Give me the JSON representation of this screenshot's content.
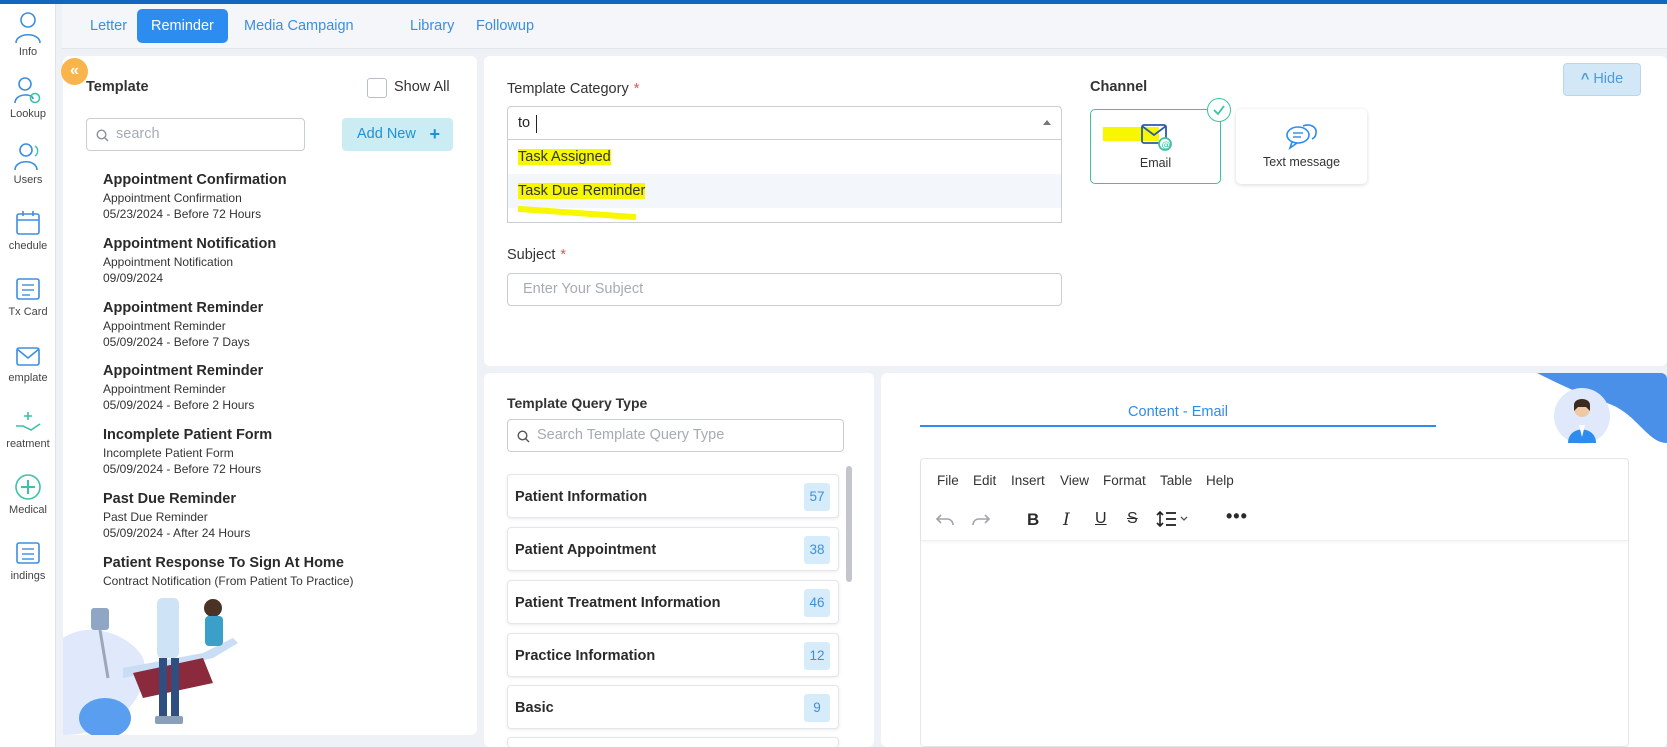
{
  "rail": {
    "items": [
      {
        "label": "Info",
        "icon": "person-icon"
      },
      {
        "label": "Lookup",
        "icon": "person-search-icon"
      },
      {
        "label": "Users",
        "icon": "users-icon"
      },
      {
        "label": "chedule",
        "icon": "calendar-icon"
      },
      {
        "label": "Tx Card",
        "icon": "card-icon"
      },
      {
        "label": "emplate",
        "icon": "mail-template-icon"
      },
      {
        "label": "reatment",
        "icon": "hand-treatment-icon"
      },
      {
        "label": "Medical",
        "icon": "medical-cross-icon"
      },
      {
        "label": "indings",
        "icon": "findings-icon"
      }
    ]
  },
  "tabs": [
    {
      "label": "Letter",
      "active": false
    },
    {
      "label": "Reminder",
      "active": true
    },
    {
      "label": "Media Campaign",
      "active": false
    },
    {
      "label": "Library",
      "active": false
    },
    {
      "label": "Followup",
      "active": false
    }
  ],
  "template_panel": {
    "title": "Template",
    "show_all_label": "Show All",
    "search_placeholder": "search",
    "add_new_label": "Add New",
    "items": [
      {
        "title": "Appointment Confirmation",
        "subtitle": "Appointment Confirmation",
        "meta": "05/23/2024 - Before 72 Hours"
      },
      {
        "title": "Appointment Notification",
        "subtitle": "Appointment Notification",
        "meta": "09/09/2024"
      },
      {
        "title": "Appointment Reminder",
        "subtitle": "Appointment Reminder",
        "meta": "05/09/2024 - Before 7 Days"
      },
      {
        "title": "Appointment Reminder",
        "subtitle": "Appointment Reminder",
        "meta": "05/09/2024 - Before 2 Hours"
      },
      {
        "title": "Incomplete Patient Form",
        "subtitle": "Incomplete Patient Form",
        "meta": "05/09/2024 - Before 72 Hours"
      },
      {
        "title": "Past Due Reminder",
        "subtitle": "Past Due Reminder",
        "meta": "05/09/2024 - After 24 Hours"
      },
      {
        "title": "Patient Response To Sign At Home",
        "subtitle": "Contract Notification (From Patient To Practice)",
        "meta": ""
      }
    ]
  },
  "form": {
    "category_label": "Template Category",
    "required_mark": "*",
    "category_value": "to",
    "dropdown_options": [
      "Task Assigned",
      "Task Due Reminder"
    ],
    "subject_label": "Subject",
    "subject_placeholder": "Enter Your Subject"
  },
  "channel": {
    "title": "Channel",
    "options": [
      {
        "label": "Email",
        "selected": true
      },
      {
        "label": "Text message",
        "selected": false
      }
    ],
    "hide_label": "Hide"
  },
  "query": {
    "title": "Template Query Type",
    "search_placeholder": "Search Template Query Type",
    "items": [
      {
        "name": "Patient Information",
        "count": "57"
      },
      {
        "name": "Patient Appointment",
        "count": "38"
      },
      {
        "name": "Patient Treatment Information",
        "count": "46"
      },
      {
        "name": "Practice Information",
        "count": "12"
      },
      {
        "name": "Basic",
        "count": "9"
      }
    ]
  },
  "editor": {
    "content_tab": "Content - Email",
    "menu": [
      "File",
      "Edit",
      "Insert",
      "View",
      "Format",
      "Table",
      "Help"
    ]
  },
  "colors": {
    "accent": "#2d8cf0",
    "topbar": "#1565c0",
    "highlight": "#f6f700",
    "channel_selected": "#3cc2a5",
    "collapse": "#f9b54c"
  }
}
